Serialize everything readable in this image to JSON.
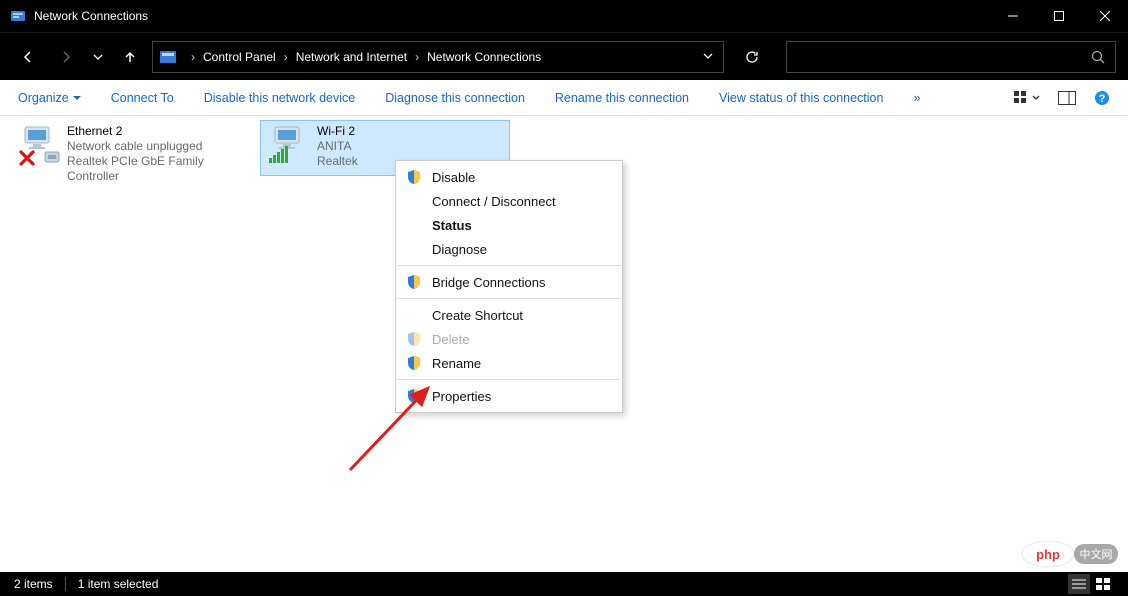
{
  "window": {
    "title": "Network Connections"
  },
  "breadcrumb": {
    "items": [
      "Control Panel",
      "Network and Internet",
      "Network Connections"
    ]
  },
  "toolbar": {
    "organize": "Organize",
    "connect_to": "Connect To",
    "disable": "Disable this network device",
    "diagnose": "Diagnose this connection",
    "rename": "Rename this connection",
    "view_status": "View status of this connection",
    "overflow": "»"
  },
  "connections": [
    {
      "name": "Ethernet 2",
      "status": "Network cable unplugged",
      "device": "Realtek PCIe GbE Family Controller",
      "selected": false,
      "unplugged": true
    },
    {
      "name": "Wi-Fi 2",
      "status": "ANITA",
      "device": "Realtek ",
      "selected": true,
      "unplugged": false
    }
  ],
  "context_menu": [
    {
      "label": "Disable",
      "shield": true
    },
    {
      "label": "Connect / Disconnect"
    },
    {
      "label": "Status",
      "bold": true
    },
    {
      "label": "Diagnose"
    },
    {
      "sep": true
    },
    {
      "label": "Bridge Connections",
      "shield": true
    },
    {
      "sep": true
    },
    {
      "label": "Create Shortcut"
    },
    {
      "label": "Delete",
      "shield": true,
      "disabled": true
    },
    {
      "label": "Rename",
      "shield": true
    },
    {
      "sep": true
    },
    {
      "label": "Properties",
      "shield": true
    }
  ],
  "statusbar": {
    "items": "2 items",
    "selected": "1 item selected"
  },
  "watermark": {
    "brand": "php",
    "text": "中文网"
  }
}
